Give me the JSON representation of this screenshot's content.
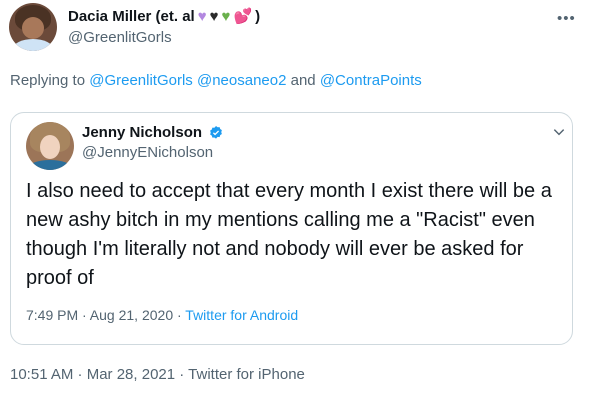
{
  "tweet": {
    "display_name": "Dacia Miller (et. al",
    "emoji_suffix": ")",
    "handle": "@GreenlitGorls",
    "replying_prefix": "Replying to",
    "mentions": [
      "@GreenlitGorls",
      "@neosaneo2"
    ],
    "and_word": "and",
    "last_mention": "@ContraPoints",
    "timestamp": "10:51 AM · Mar 28, 2021 · ",
    "source": "Twitter for iPhone",
    "emoji_colors": [
      "#b388e0",
      "#2b2b2b",
      "#6ab04c",
      "#e0245e"
    ]
  },
  "quoted": {
    "display_name": "Jenny Nicholson",
    "handle": "@JennyENicholson",
    "text": "I also need to accept that every month I exist there will be a new ashy bitch in my mentions calling me a \"Racist\" even though I'm literally not and nobody will ever be asked for proof of",
    "time": "7:49 PM · Aug 21, 2020 · ",
    "source": "Twitter for Android",
    "verified_color": "#1d9bf0"
  },
  "icons": {
    "more": "more-icon",
    "chevron": "chevron-down-icon",
    "verified": "verified-badge-icon"
  }
}
